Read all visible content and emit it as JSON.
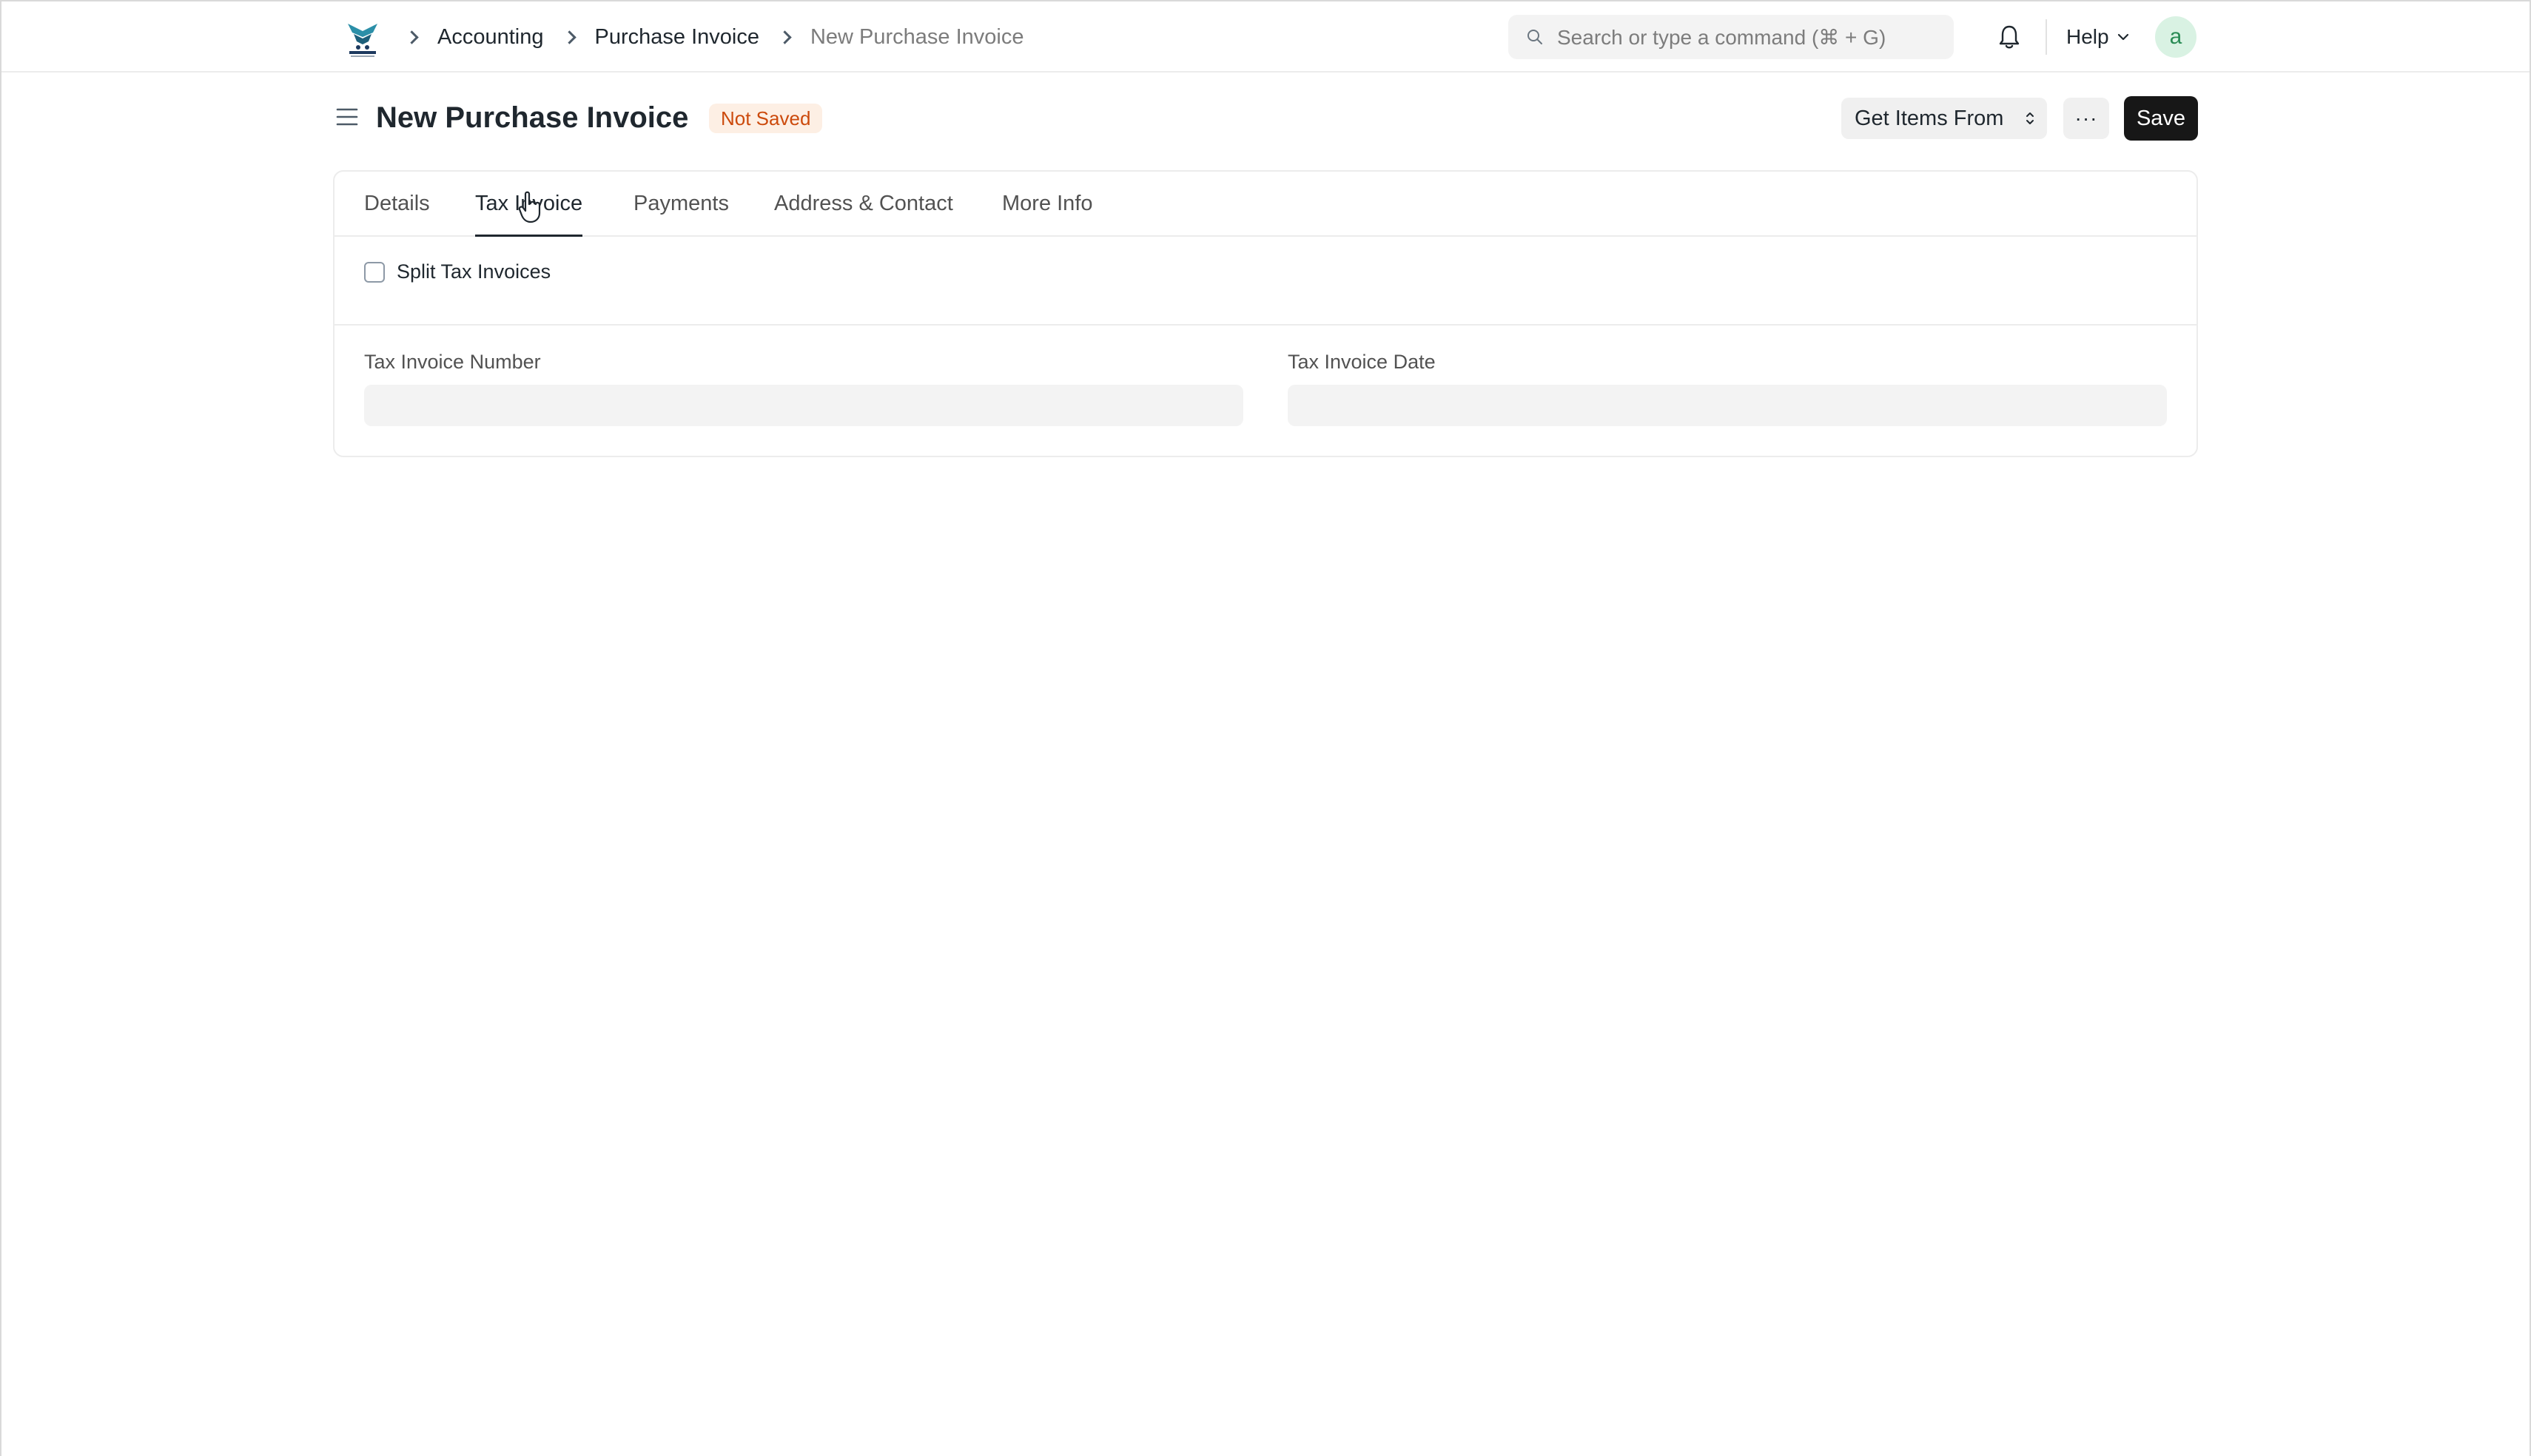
{
  "navbar": {
    "breadcrumbs": [
      "Accounting",
      "Purchase Invoice"
    ],
    "breadcrumb_current": "New Purchase Invoice",
    "search_placeholder": "Search or type a command (⌘ + G)",
    "help_label": "Help",
    "avatar_initial": "a"
  },
  "page": {
    "title": "New Purchase Invoice",
    "status": "Not Saved",
    "get_items_label": "Get Items From",
    "more_label": "···",
    "save_label": "Save"
  },
  "tabs": [
    {
      "label": "Details",
      "active": false
    },
    {
      "label": "Tax Invoice",
      "active": true
    },
    {
      "label": "Payments",
      "active": false
    },
    {
      "label": "Address & Contact",
      "active": false
    },
    {
      "label": "More Info",
      "active": false
    }
  ],
  "form": {
    "split_label": "Split Tax Invoices",
    "split_checked": false,
    "tax_invoice_number_label": "Tax Invoice Number",
    "tax_invoice_number_value": "",
    "tax_invoice_date_label": "Tax Invoice Date",
    "tax_invoice_date_value": ""
  },
  "colors": {
    "status_badge_bg": "#fdefe4",
    "status_badge_text": "#cc4a0c",
    "primary_button": "#171717",
    "avatar_bg": "#d9f2e3"
  }
}
